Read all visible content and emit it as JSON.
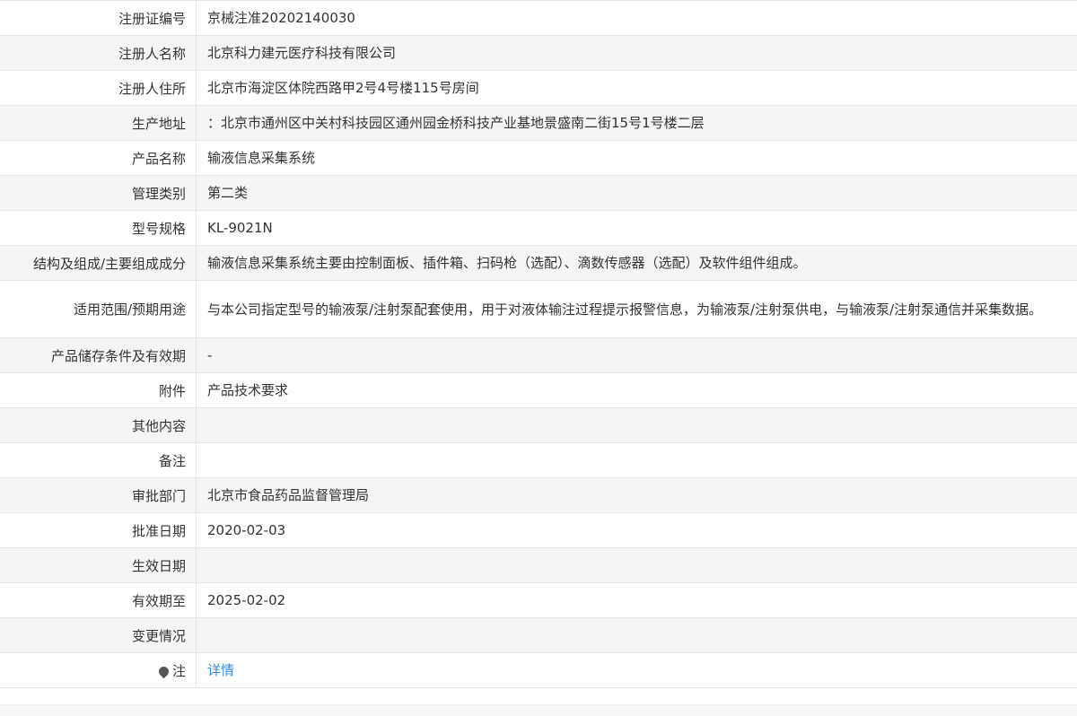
{
  "rows": [
    {
      "label": "注册证编号",
      "value": "京械注准20202140030"
    },
    {
      "label": "注册人名称",
      "value": "北京科力建元医疗科技有限公司"
    },
    {
      "label": "注册人住所",
      "value": "北京市海淀区体院西路甲2号4号楼115号房间"
    },
    {
      "label": "生产地址",
      "value": "：北京市通州区中关村科技园区通州园金桥科技产业基地景盛南二街15号1号楼二层"
    },
    {
      "label": "产品名称",
      "value": "输液信息采集系统"
    },
    {
      "label": "管理类别",
      "value": "第二类"
    },
    {
      "label": "型号规格",
      "value": "KL-9021N"
    },
    {
      "label": "结构及组成/主要组成成分",
      "value": "输液信息采集系统主要由控制面板、插件箱、扫码枪（选配）、滴数传感器（选配）及软件组件组成。"
    },
    {
      "label": "适用范围/预期用途",
      "value": "与本公司指定型号的输液泵/注射泵配套使用，用于对液体输注过程提示报警信息，为输液泵/注射泵供电，与输液泵/注射泵通信并采集数据。"
    },
    {
      "label": "产品储存条件及有效期",
      "value": "-"
    },
    {
      "label": "附件",
      "value": "产品技术要求"
    },
    {
      "label": "其他内容",
      "value": ""
    },
    {
      "label": "备注",
      "value": ""
    },
    {
      "label": "审批部门",
      "value": "北京市食品药品监督管理局"
    },
    {
      "label": "批准日期",
      "value": "2020-02-03"
    },
    {
      "label": "生效日期",
      "value": ""
    },
    {
      "label": "有效期至",
      "value": "2025-02-02"
    },
    {
      "label": "变更情况",
      "value": ""
    },
    {
      "label": "注",
      "value": "详情",
      "icon": "pin-icon"
    }
  ]
}
